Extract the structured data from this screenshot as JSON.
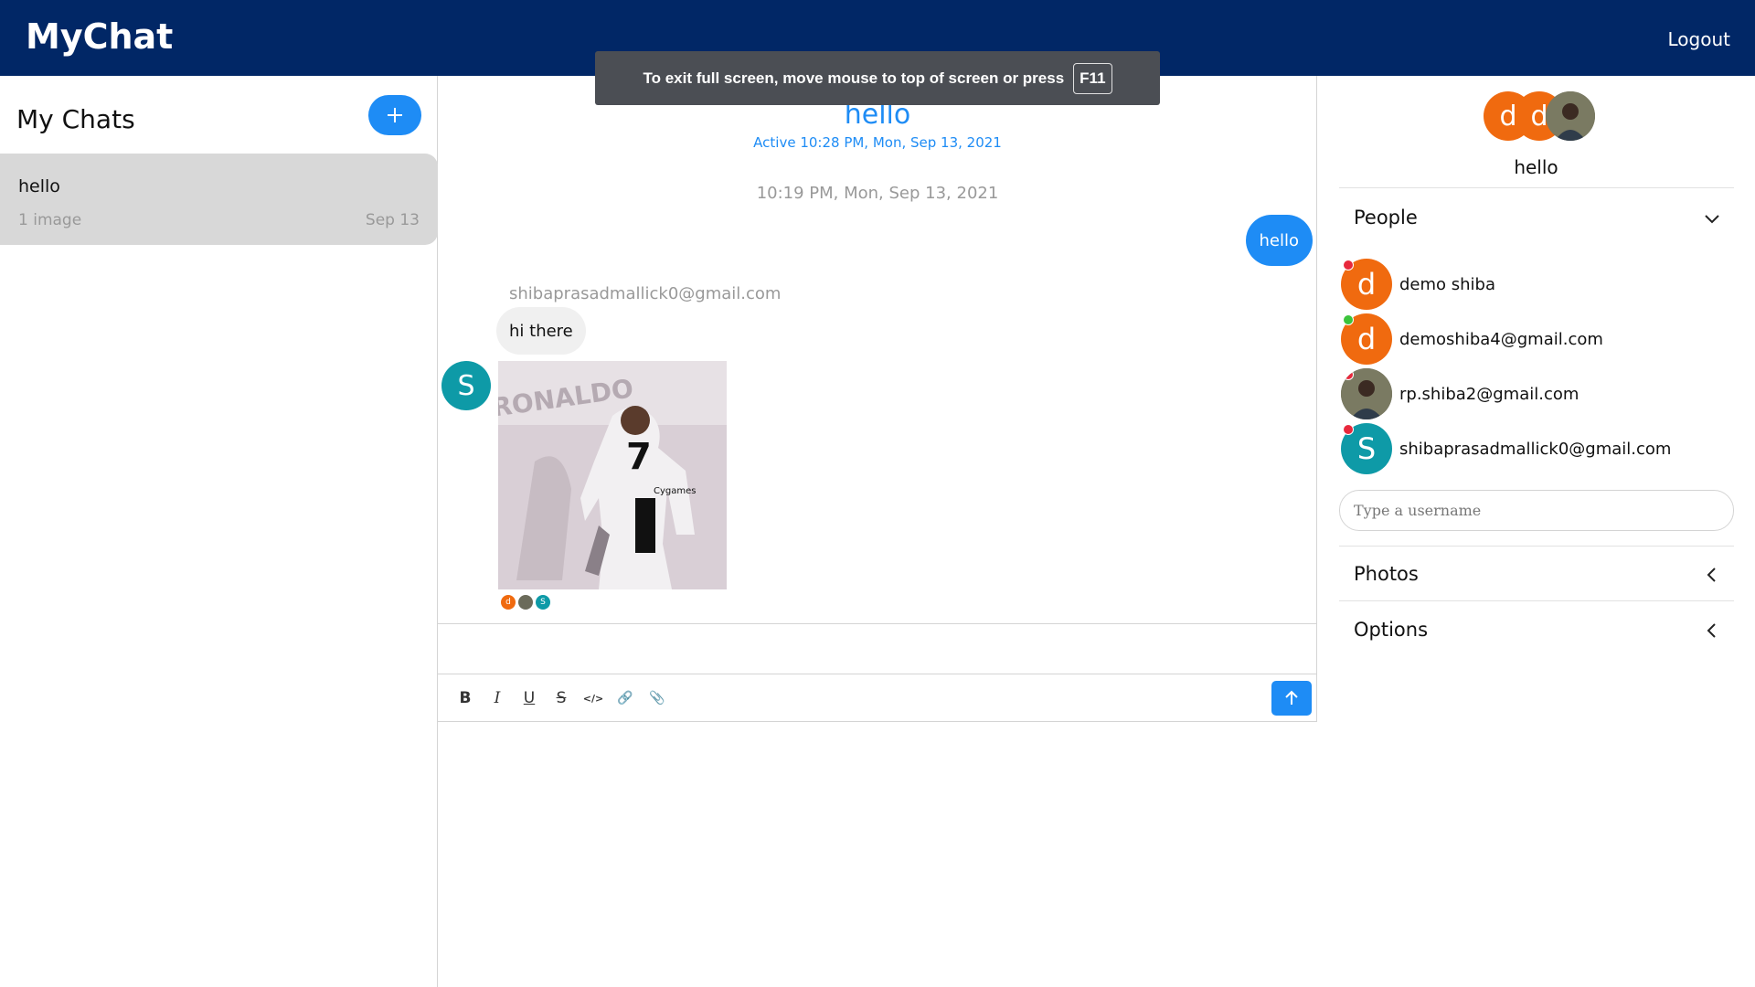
{
  "app": {
    "brand": "MyChat",
    "logout_label": "Logout"
  },
  "fullscreen_toast": {
    "message": "To exit full screen, move mouse to top of screen or press",
    "key": "F11"
  },
  "sidebar": {
    "title": "My Chats",
    "new_chat_icon": "plus-icon",
    "chats": [
      {
        "title": "hello",
        "last_message": "1 image",
        "date": "Sep 13"
      }
    ]
  },
  "conversation": {
    "title": "hello",
    "active_status": "Active 10:28 PM, Mon, Sep 13, 2021",
    "timestamp": "10:19 PM, Mon, Sep 13, 2021",
    "messages": [
      {
        "author": "me",
        "text": "hello"
      },
      {
        "author": "shibaprasadmallick0@gmail.com",
        "avatar_letter": "S",
        "text": "hi there"
      }
    ],
    "image_jersey": {
      "name": "RONALDO",
      "number": "7",
      "sponsor": "Cygames"
    },
    "read_receipts": [
      {
        "letter": "d",
        "color": "#f06a0f"
      },
      {
        "letter": "",
        "color": "#6b6b5a"
      },
      {
        "letter": "S",
        "color": "#0e9aa7"
      }
    ],
    "composer": {
      "placeholder": ""
    },
    "toolbar_icons": [
      "bold-icon",
      "italic-icon",
      "underline-icon",
      "strikethrough-icon",
      "code-icon",
      "link-icon",
      "attachment-icon"
    ],
    "tool_glyphs": [
      "B",
      "I",
      "U",
      "S",
      "</>",
      "🔗",
      "📎"
    ],
    "send_icon": "arrow-up-icon"
  },
  "details": {
    "group_name": "hello",
    "group_avatars": [
      {
        "letter": "d",
        "color": "#f06a0f"
      },
      {
        "letter": "d",
        "color": "#f06a0f"
      },
      {
        "letter": "",
        "color": "#6b6b5a"
      }
    ],
    "people_title": "People",
    "people": [
      {
        "name": "demo shiba",
        "letter": "d",
        "color": "#f06a0f",
        "status": "#e8283c"
      },
      {
        "name": "demoshiba4@gmail.com",
        "letter": "d",
        "color": "#f06a0f",
        "status": "#3bc43b"
      },
      {
        "name": "rp.shiba2@gmail.com",
        "letter": "",
        "color": "#6b6b5a",
        "status": "#e8283c"
      },
      {
        "name": "shibaprasadmallick0@gmail.com",
        "letter": "S",
        "color": "#0e9aa7",
        "status": "#e8283c"
      }
    ],
    "username_placeholder": "Type a username",
    "photos_title": "Photos",
    "options_title": "Options"
  },
  "colors": {
    "header": "#012766",
    "accent": "#1e8cf5",
    "selected_chat": "#d8d8d8"
  }
}
